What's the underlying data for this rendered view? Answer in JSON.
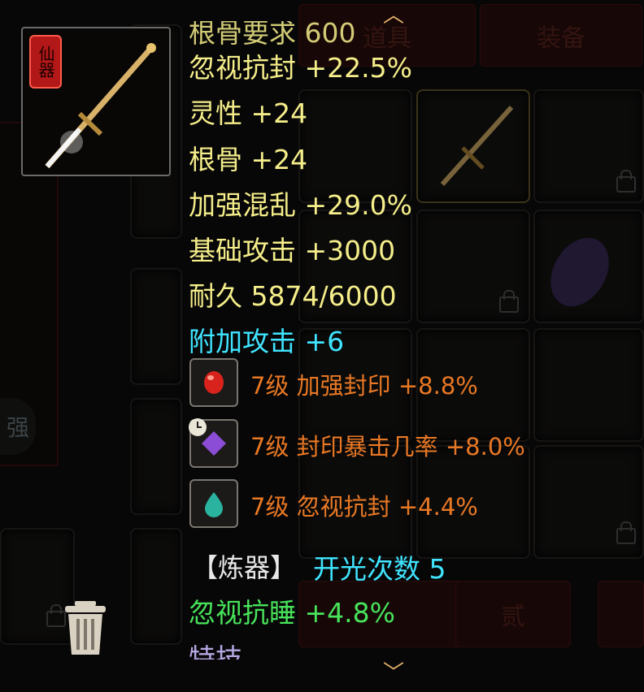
{
  "tabs": {
    "item_tab": "道具",
    "equip_tab": "装备"
  },
  "side_tab_label": "强",
  "bottom_tab_label": "贰",
  "item": {
    "badge": "仙器",
    "cut_top_text": "根骨要求 600",
    "stats": [
      "忽视抗封 +22.5%",
      "灵性 +24",
      "根骨 +24",
      "加强混乱 +29.0%",
      "基础攻击 +3000",
      "耐久 5874/6000"
    ],
    "extra_attack": "附加攻击 +6",
    "gems": [
      {
        "text": "7级 加强封印 +8.8%",
        "color": "#d8231c",
        "icon": "red-gem-icon"
      },
      {
        "text": "7级 封印暴击几率 +8.0%",
        "color": "#8b4cd6",
        "icon": "purple-gem-icon"
      },
      {
        "text": "7级 忽视抗封 +4.4%",
        "color": "#2ab39e",
        "icon": "teal-gem-icon"
      }
    ],
    "refine_label": "【炼器】",
    "refine_value": "开光次数 5",
    "refine_stat": "忽视抗睡 +4.8%",
    "cut_bottom_text": "特技"
  },
  "colors": {
    "yellow": "#f5ee8a",
    "cyan": "#3fe4ff",
    "green": "#47e35b",
    "orange": "#e97824"
  }
}
